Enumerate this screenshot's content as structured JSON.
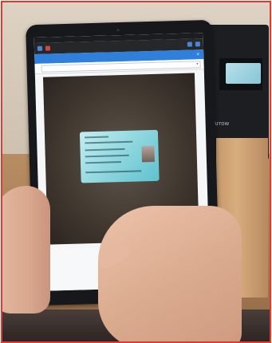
{
  "scene": {
    "browser": {
      "address": "",
      "status_left": "",
      "status_right": ""
    },
    "app": {
      "header_title": "",
      "close_icon": "×"
    },
    "toolbar": {
      "label": "",
      "select_value": ""
    },
    "background_device": {
      "brand": "Arrow"
    }
  }
}
